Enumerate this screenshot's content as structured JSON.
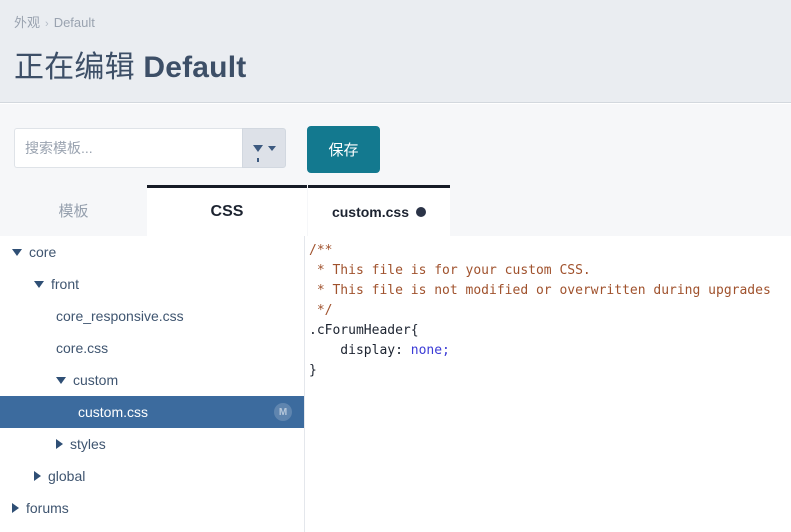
{
  "header": {
    "breadcrumb": [
      {
        "label": "外观",
        "link": true
      },
      {
        "label": "Default",
        "link": false
      }
    ],
    "separator": "›",
    "title_prefix": "正在编辑 ",
    "title_name": "Default"
  },
  "toolbar": {
    "search_placeholder": "搜索模板...",
    "search_value": "",
    "filter_icon": "funnel-icon",
    "filter_caret_icon": "chevron-down-icon",
    "save_label": "保存",
    "save_color": "#13798f"
  },
  "tabs": [
    {
      "id": "templates",
      "label": "模板",
      "active": false
    },
    {
      "id": "css",
      "label": "CSS",
      "active": true
    }
  ],
  "file_tab": {
    "label": "custom.css",
    "dirty": true,
    "dirty_icon": "unsaved-dot-icon"
  },
  "tree": {
    "selected_badge": "M",
    "items": [
      {
        "label": "core",
        "depth": 0,
        "state": "open",
        "selected": false,
        "type": "folder"
      },
      {
        "label": "front",
        "depth": 1,
        "state": "open",
        "selected": false,
        "type": "folder"
      },
      {
        "label": "core_responsive.css",
        "depth": 2,
        "state": "leaf",
        "selected": false,
        "type": "file"
      },
      {
        "label": "core.css",
        "depth": 2,
        "state": "leaf",
        "selected": false,
        "type": "file"
      },
      {
        "label": "custom",
        "depth": 2,
        "state": "open",
        "selected": false,
        "type": "folder"
      },
      {
        "label": "custom.css",
        "depth": 3,
        "state": "leaf",
        "selected": true,
        "type": "file"
      },
      {
        "label": "styles",
        "depth": 2,
        "state": "closed",
        "selected": false,
        "type": "folder"
      },
      {
        "label": "global",
        "depth": 1,
        "state": "closed",
        "selected": false,
        "type": "folder"
      },
      {
        "label": "forums",
        "depth": 0,
        "state": "closed",
        "selected": false,
        "type": "folder"
      }
    ]
  },
  "editor": {
    "language": "css",
    "lines": [
      [
        {
          "t": "/**",
          "c": "comment"
        }
      ],
      [
        {
          "t": " * This file is for your custom CSS.",
          "c": "comment"
        }
      ],
      [
        {
          "t": " * This file is not modified or overwritten during upgrades",
          "c": "comment"
        }
      ],
      [
        {
          "t": " */",
          "c": "comment"
        }
      ],
      [
        {
          "t": ".cForumHeader{",
          "c": "sel"
        }
      ],
      [
        {
          "t": "    display: ",
          "c": "prop"
        },
        {
          "t": "none;",
          "c": "val"
        }
      ],
      [
        {
          "t": "}",
          "c": "punc"
        }
      ]
    ]
  },
  "colors": {
    "header_bg": "#eaedf1",
    "toolbar_bg": "#f6f7f9",
    "accent_teal": "#13798f",
    "tree_selected": "#3c6b9e",
    "tab_active_border": "#161b26"
  }
}
